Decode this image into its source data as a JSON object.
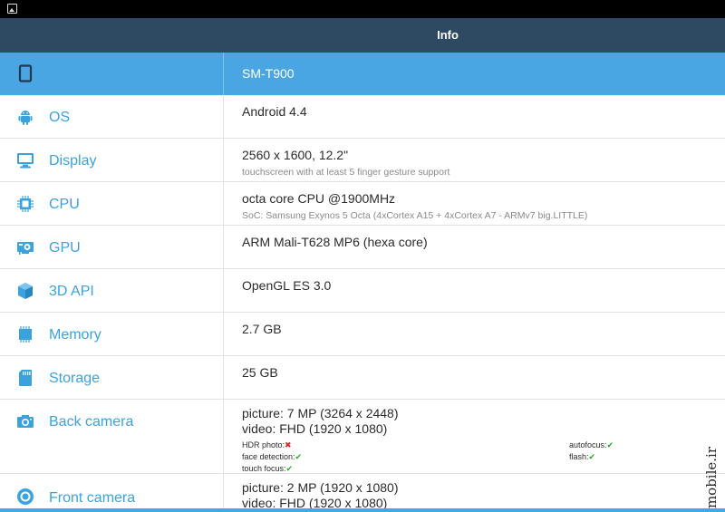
{
  "window": {
    "title": "Info"
  },
  "device": {
    "model": "SM-T900"
  },
  "rows": [
    {
      "label": "OS",
      "value": "Android 4.4",
      "sub": "",
      "icon": "android-icon"
    },
    {
      "label": "Display",
      "value": "2560 x 1600, 12.2\"",
      "sub": "touchscreen with at least 5 finger gesture support",
      "icon": "monitor-icon"
    },
    {
      "label": "CPU",
      "value": "octa core CPU @1900MHz",
      "sub": "SoC: Samsung Exynos 5 Octa (4xCortex A15 + 4xCortex A7 - ARMv7 big.LITTLE)",
      "icon": "chip-icon"
    },
    {
      "label": "GPU",
      "value": "ARM Mali-T628 MP6 (hexa core)",
      "sub": "",
      "icon": "graphics-card-icon"
    },
    {
      "label": "3D API",
      "value": "OpenGL ES 3.0",
      "sub": "",
      "icon": "cube-icon"
    },
    {
      "label": "Memory",
      "value": "2.7 GB",
      "sub": "",
      "icon": "memory-icon"
    },
    {
      "label": "Storage",
      "value": "25 GB",
      "sub": "",
      "icon": "sd-card-icon"
    }
  ],
  "back_camera": {
    "label": "Back camera",
    "picture": "picture: 7 MP (3264 x 2448)",
    "video": "video: FHD (1920 x 1080)",
    "features": {
      "hdr_photo": "HDR photo:",
      "face_detection": "face detection:",
      "touch_focus": "touch focus:",
      "autofocus": "autofocus:",
      "flash": "flash:"
    },
    "marks": {
      "yes": "✔",
      "no": "✖"
    }
  },
  "front_camera": {
    "label": "Front camera",
    "picture": "picture: 2 MP (1920 x 1080)",
    "video": "video: FHD (1920 x 1080)"
  },
  "watermark": {
    "text": "mobile.ir"
  },
  "colors": {
    "accent": "#3aa3dd",
    "header_bg": "#4aa6e3",
    "titlebar_bg": "#2e4a62",
    "yes": "#2aa52a",
    "no": "#d42a2a"
  }
}
